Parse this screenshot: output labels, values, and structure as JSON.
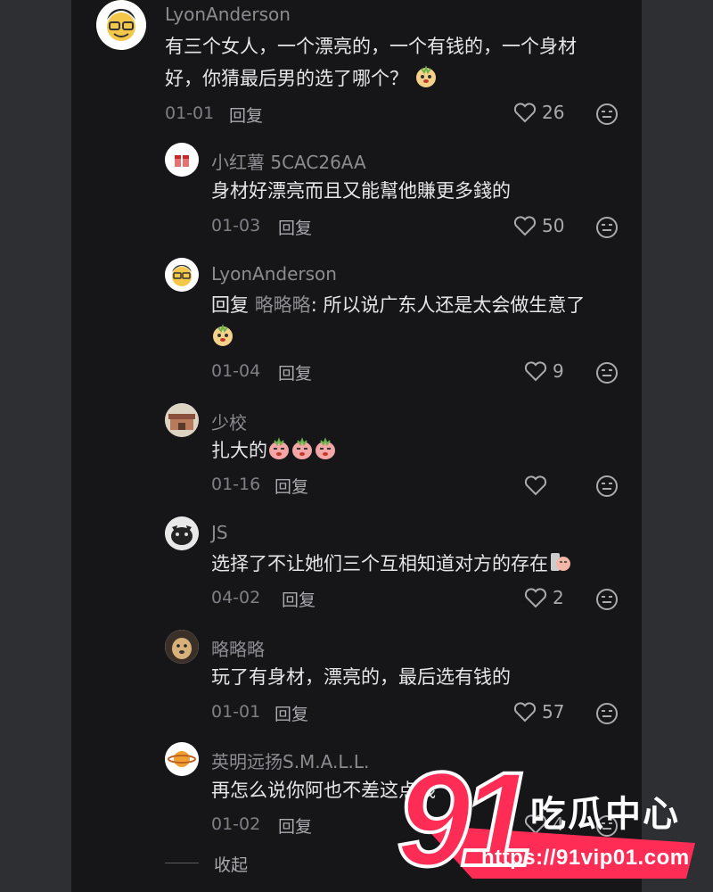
{
  "comments": [
    {
      "user": "LyonAnderson",
      "text": "有三个女人，一个漂亮的，一个有钱的，一个身材",
      "text2": "好，你猜最后男的选了哪个？",
      "date": "01-01",
      "reply": "回复",
      "likes": "26"
    },
    {
      "user": "小红薯 5CAC26AA",
      "text": "身材好漂亮而且又能幫他賺更多錢的",
      "date": "01-03",
      "reply": "回复",
      "likes": "50"
    },
    {
      "user": "LyonAnderson",
      "prefix": "回复 ",
      "mention": "略略略",
      "text": ": 所以说广东人还是太会做生意了",
      "date": "01-04",
      "reply": "回复",
      "likes": "9"
    },
    {
      "user": "少校",
      "text": "扎大的",
      "date": "01-16",
      "reply": "回复",
      "likes": ""
    },
    {
      "user": "JS",
      "text": "选择了不让她们三个互相知道对方的存在",
      "date": "04-02",
      "reply": "回复",
      "likes": "2"
    },
    {
      "user": "略略略",
      "text": "玩了有身材，漂亮的，最后选有钱的",
      "date": "01-01",
      "reply": "回复",
      "likes": "57"
    },
    {
      "user": "英明远扬S.M.A.L.L.",
      "text": "再怎么说你阿也不差这点钱",
      "date": "01-02",
      "reply": "回复",
      "likes": "4"
    }
  ],
  "collapse_label": "收起",
  "watermark": {
    "number": "91",
    "title": "吃瓜中心",
    "url": "https://91vip01.com"
  },
  "colors": {
    "background": "#161619",
    "accent": "#ff2d55"
  }
}
